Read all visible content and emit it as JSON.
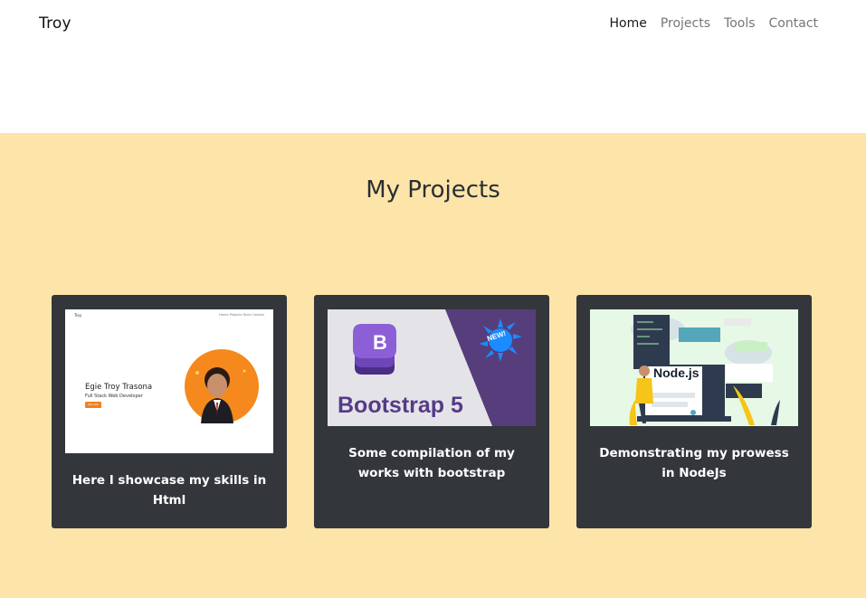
{
  "nav": {
    "brand": "Troy",
    "links": [
      {
        "label": "Home",
        "active": true
      },
      {
        "label": "Projects",
        "active": false
      },
      {
        "label": "Tools",
        "active": false
      },
      {
        "label": "Contact",
        "active": false
      }
    ]
  },
  "projects": {
    "title": "My Projects",
    "cards": [
      {
        "text": "Here I showcase my skills in Html",
        "thumbnail": {
          "brand": "Troy",
          "nav": "Home  Projects  Tools  Contact",
          "name": "Egie Troy Trasona",
          "role": "Full Stack Web Developer",
          "button": "Hire Me"
        }
      },
      {
        "text": "Some compilation of my works with bootstrap",
        "thumbnail": {
          "word": "Bootstrap 5",
          "badge": "NEW!",
          "logo_letter": "B"
        }
      },
      {
        "text": "Demonstrating my prowess in NodeJs",
        "thumbnail": {
          "label": "Node.js"
        }
      }
    ]
  },
  "colors": {
    "section_bg": "#fde5a9",
    "card_bg": "#33363b",
    "bootstrap_purple": "#7952b3",
    "accent_orange": "#f0811f"
  }
}
